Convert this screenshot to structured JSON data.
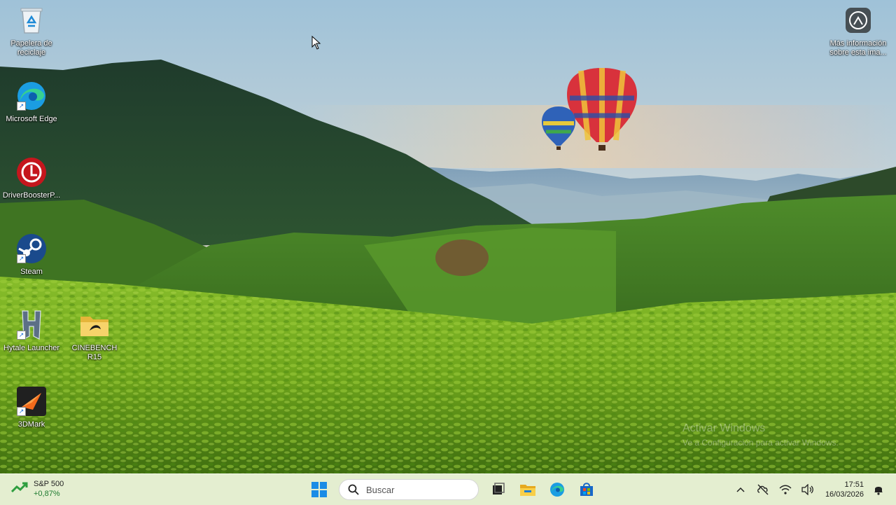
{
  "desktop": {
    "icons": [
      {
        "label": "Papelera de reciclaje",
        "icon": "recycle-bin-icon"
      },
      {
        "label": "Microsoft Edge",
        "icon": "edge-icon"
      },
      {
        "label": "DriverBoosterP...",
        "icon": "driver-booster-icon"
      },
      {
        "label": "Steam",
        "icon": "steam-icon"
      },
      {
        "label": "Hytale Launcher",
        "icon": "hytale-icon"
      },
      {
        "label": "CINEBENCH R15",
        "icon": "folder-icon"
      },
      {
        "label": "3DMark",
        "icon": "3dmark-icon"
      }
    ],
    "info_icon": {
      "label": "Más información sobre esta ima...",
      "icon": "camera-info-icon"
    },
    "watermark": {
      "title": "Activar Windows",
      "subtitle": "Ve a Configuración para activar Windows."
    }
  },
  "taskbar": {
    "widget": {
      "name": "S&P 500",
      "change": "+0,87%",
      "icon": "stock-up-icon"
    },
    "search_placeholder": "Buscar",
    "pinned": [
      "start-icon",
      "task-view-icon",
      "file-explorer-icon",
      "edge-icon",
      "store-icon"
    ],
    "tray": {
      "icons": [
        "chevron-up-icon",
        "no-sync-icon",
        "wifi-icon",
        "speaker-icon"
      ]
    },
    "clock": {
      "time": "17:51",
      "date": "16/03/2026"
    },
    "notification_icon": "bell-icon"
  },
  "colors": {
    "taskbar": "#e3edce",
    "accent": "#0078d4"
  }
}
